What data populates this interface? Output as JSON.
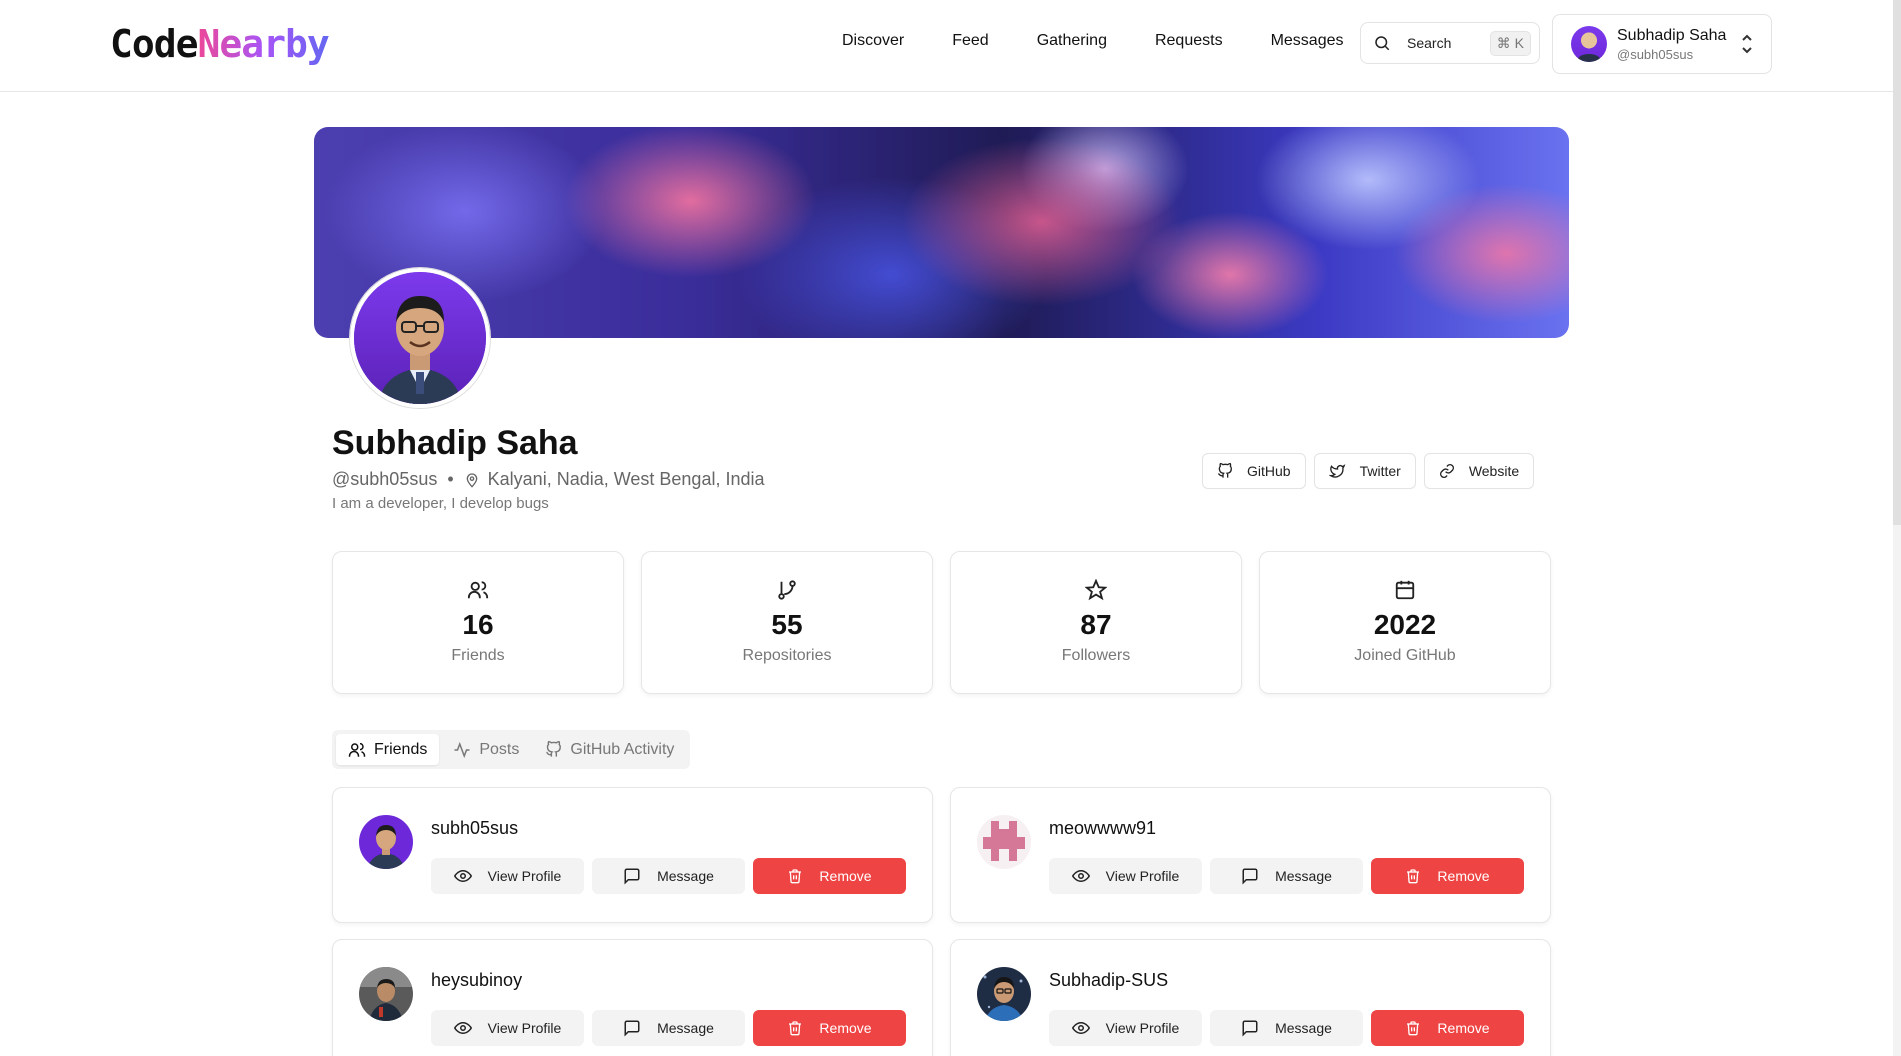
{
  "header": {
    "logo_part1": "Code",
    "logo_part2": "Nearby",
    "nav": [
      "Discover",
      "Feed",
      "Gathering",
      "Requests",
      "Messages"
    ],
    "search_label": "Search",
    "search_shortcut": "⌘ K",
    "user_name": "Subhadip Saha",
    "user_handle": "@subh05sus"
  },
  "profile": {
    "name": "Subhadip Saha",
    "handle": "@subh05sus",
    "location": "Kalyani, Nadia, West Bengal, India",
    "bio": "I am a developer, I develop bugs",
    "links": [
      "GitHub",
      "Twitter",
      "Website"
    ]
  },
  "stats": [
    {
      "value": "16",
      "label": "Friends",
      "icon": "users-icon"
    },
    {
      "value": "55",
      "label": "Repositories",
      "icon": "git-branch-icon"
    },
    {
      "value": "87",
      "label": "Followers",
      "icon": "star-icon"
    },
    {
      "value": "2022",
      "label": "Joined GitHub",
      "icon": "calendar-icon"
    }
  ],
  "tabs": [
    "Friends",
    "Posts",
    "GitHub Activity"
  ],
  "friend_actions": {
    "view": "View Profile",
    "message": "Message",
    "remove": "Remove"
  },
  "friends": [
    {
      "username": "subh05sus"
    },
    {
      "username": "meowwww91"
    },
    {
      "username": "heysubinoy"
    },
    {
      "username": "Subhadip-SUS"
    }
  ],
  "colors": {
    "accent_red": "#ef4444",
    "logo_gradient": [
      "#ec4899",
      "#a855f7",
      "#6366f1"
    ]
  }
}
